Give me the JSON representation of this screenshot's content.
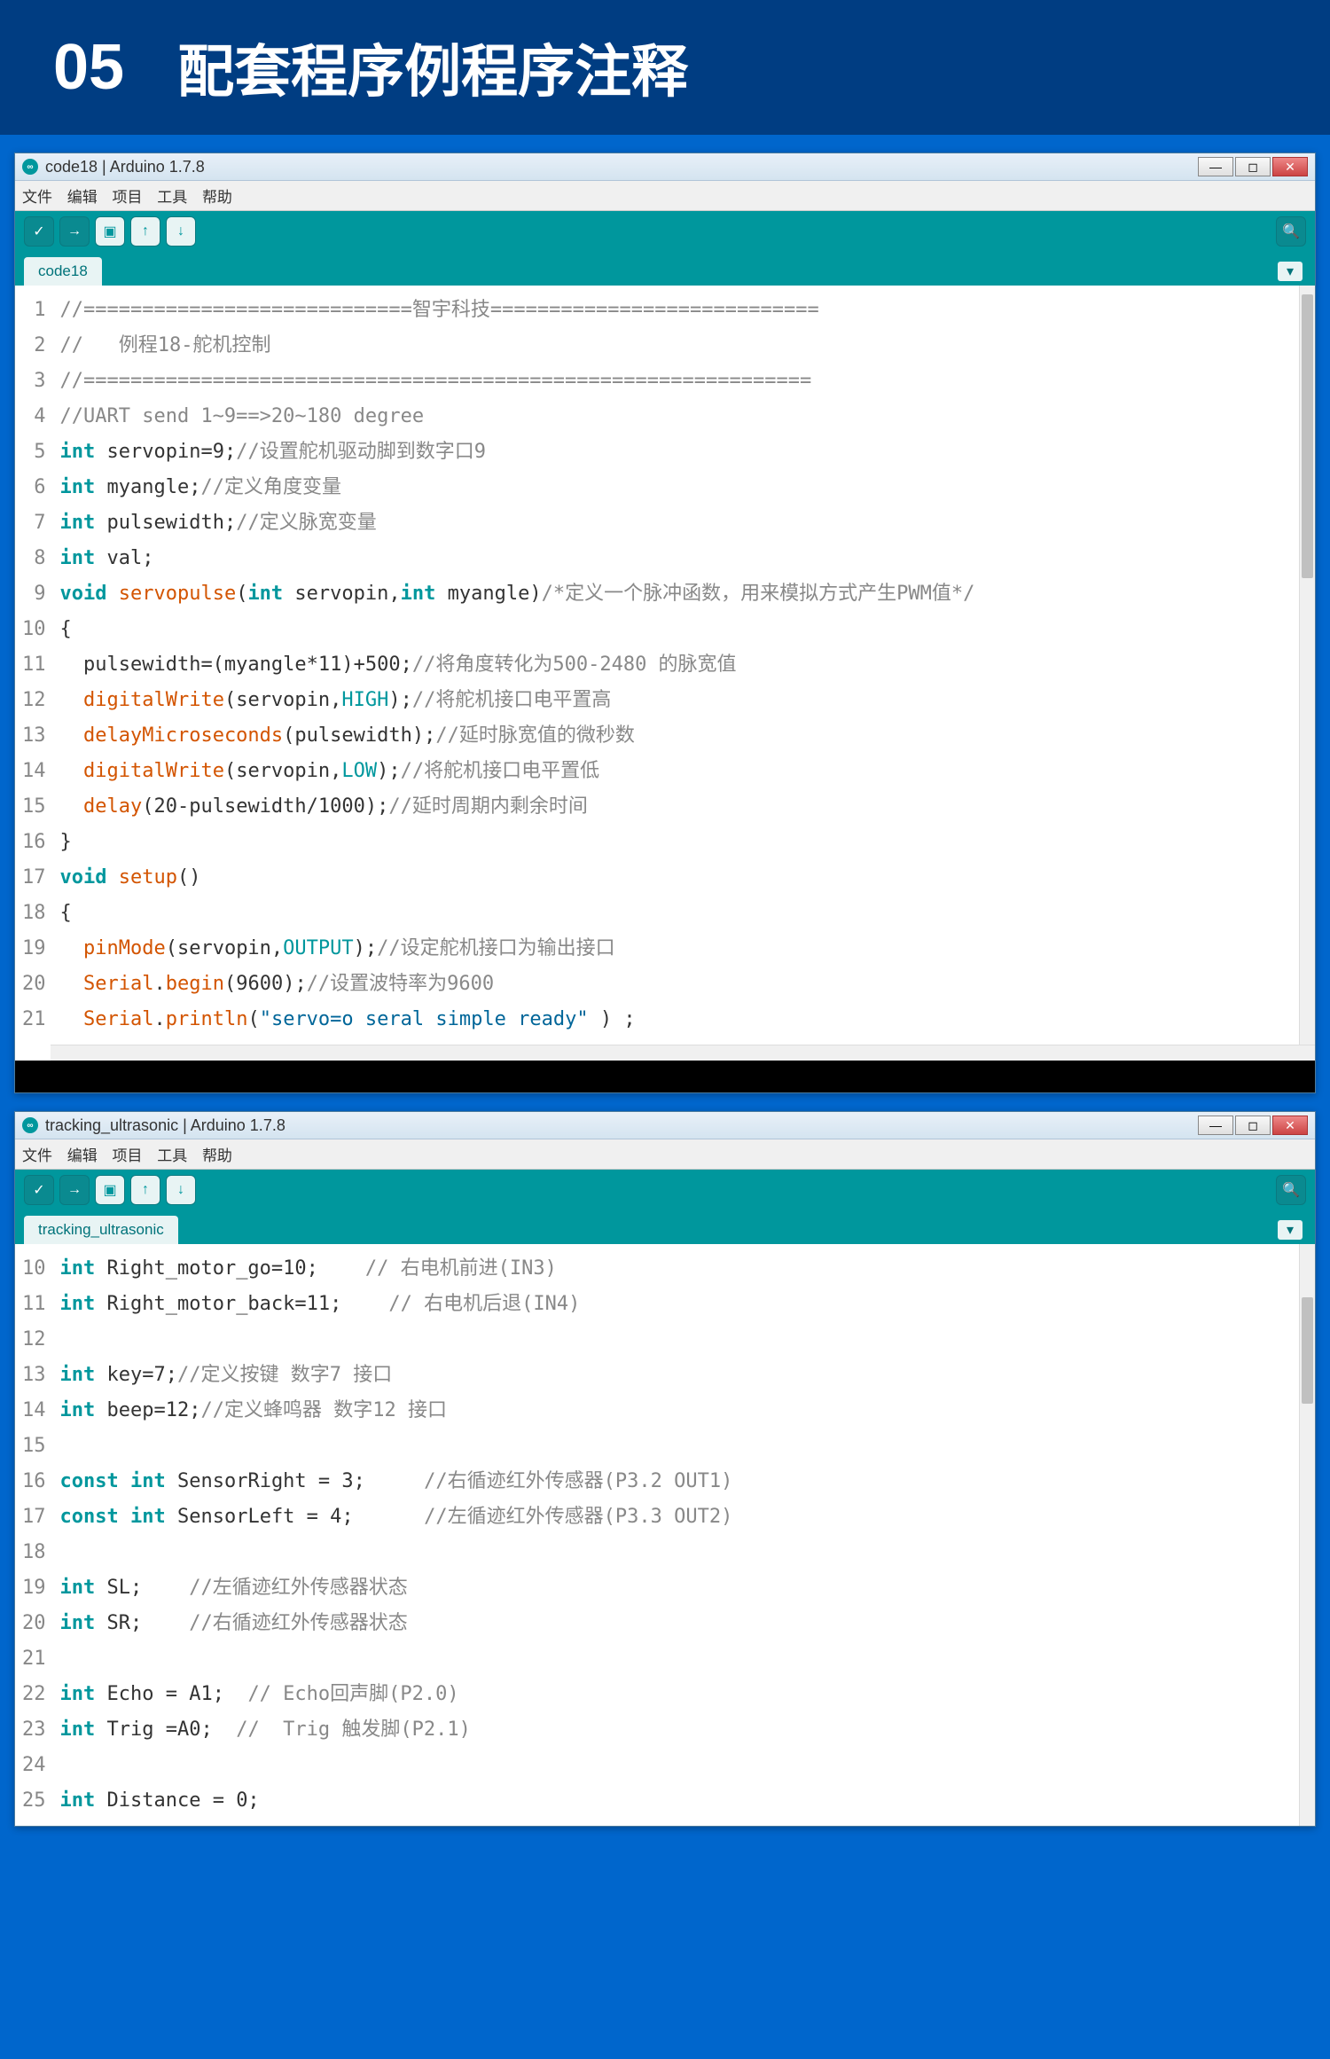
{
  "banner": {
    "num": "05",
    "title": "配套程序例程序注释"
  },
  "window1": {
    "title": "code18 | Arduino 1.7.8",
    "menus": [
      "文件",
      "编辑",
      "项目",
      "工具",
      "帮助"
    ],
    "tab": "code18",
    "lines": [
      {
        "n": 1,
        "tokens": [
          {
            "t": "//============================智宇科技============================",
            "c": "k-cmt"
          }
        ]
      },
      {
        "n": 2,
        "tokens": [
          {
            "t": "//   例程18-舵机控制",
            "c": "k-cmt"
          }
        ]
      },
      {
        "n": 3,
        "tokens": [
          {
            "t": "//==============================================================",
            "c": "k-cmt"
          }
        ]
      },
      {
        "n": 4,
        "tokens": [
          {
            "t": "//UART send 1~9==>20~180 degree",
            "c": "k-cmt"
          }
        ]
      },
      {
        "n": 5,
        "tokens": [
          {
            "t": "int",
            "c": "k-type"
          },
          {
            "t": " servopin=9;"
          },
          {
            "t": "//设置舵机驱动脚到数字口9",
            "c": "k-cmt"
          }
        ]
      },
      {
        "n": 6,
        "tokens": [
          {
            "t": "int",
            "c": "k-type"
          },
          {
            "t": " myangle;"
          },
          {
            "t": "//定义角度变量",
            "c": "k-cmt"
          }
        ]
      },
      {
        "n": 7,
        "tokens": [
          {
            "t": "int",
            "c": "k-type"
          },
          {
            "t": " pulsewidth;"
          },
          {
            "t": "//定义脉宽变量",
            "c": "k-cmt"
          }
        ]
      },
      {
        "n": 8,
        "tokens": [
          {
            "t": "int",
            "c": "k-type"
          },
          {
            "t": " val;"
          }
        ]
      },
      {
        "n": 9,
        "tokens": [
          {
            "t": "void",
            "c": "k-type"
          },
          {
            "t": " "
          },
          {
            "t": "servopulse",
            "c": "k-func"
          },
          {
            "t": "("
          },
          {
            "t": "int",
            "c": "k-type"
          },
          {
            "t": " servopin,"
          },
          {
            "t": "int",
            "c": "k-type"
          },
          {
            "t": " myangle)"
          },
          {
            "t": "/*定义一个脉冲函数，用来模拟方式产生PWM值*/",
            "c": "k-cmt"
          }
        ]
      },
      {
        "n": 10,
        "tokens": [
          {
            "t": "{"
          }
        ]
      },
      {
        "n": 11,
        "tokens": [
          {
            "t": "  pulsewidth=(myangle*11)+500;"
          },
          {
            "t": "//将角度转化为500-2480 的脉宽值",
            "c": "k-cmt"
          }
        ]
      },
      {
        "n": 12,
        "tokens": [
          {
            "t": "  "
          },
          {
            "t": "digitalWrite",
            "c": "k-func"
          },
          {
            "t": "(servopin,"
          },
          {
            "t": "HIGH",
            "c": "k-const"
          },
          {
            "t": ");"
          },
          {
            "t": "//将舵机接口电平置高",
            "c": "k-cmt"
          }
        ]
      },
      {
        "n": 13,
        "tokens": [
          {
            "t": "  "
          },
          {
            "t": "delayMicroseconds",
            "c": "k-func"
          },
          {
            "t": "(pulsewidth);"
          },
          {
            "t": "//延时脉宽值的微秒数",
            "c": "k-cmt"
          }
        ]
      },
      {
        "n": 14,
        "tokens": [
          {
            "t": "  "
          },
          {
            "t": "digitalWrite",
            "c": "k-func"
          },
          {
            "t": "(servopin,"
          },
          {
            "t": "LOW",
            "c": "k-const"
          },
          {
            "t": ");"
          },
          {
            "t": "//将舵机接口电平置低",
            "c": "k-cmt"
          }
        ]
      },
      {
        "n": 15,
        "tokens": [
          {
            "t": "  "
          },
          {
            "t": "delay",
            "c": "k-func"
          },
          {
            "t": "(20-pulsewidth/1000);"
          },
          {
            "t": "//延时周期内剩余时间",
            "c": "k-cmt"
          }
        ]
      },
      {
        "n": 16,
        "tokens": [
          {
            "t": "}"
          }
        ]
      },
      {
        "n": 17,
        "tokens": [
          {
            "t": "void",
            "c": "k-type"
          },
          {
            "t": " "
          },
          {
            "t": "setup",
            "c": "k-func"
          },
          {
            "t": "()"
          }
        ]
      },
      {
        "n": 18,
        "tokens": [
          {
            "t": "{"
          }
        ]
      },
      {
        "n": 19,
        "tokens": [
          {
            "t": "  "
          },
          {
            "t": "pinMode",
            "c": "k-func"
          },
          {
            "t": "(servopin,"
          },
          {
            "t": "OUTPUT",
            "c": "k-const"
          },
          {
            "t": ");"
          },
          {
            "t": "//设定舵机接口为输出接口",
            "c": "k-cmt"
          }
        ]
      },
      {
        "n": 20,
        "tokens": [
          {
            "t": "  "
          },
          {
            "t": "Serial",
            "c": "k-func"
          },
          {
            "t": "."
          },
          {
            "t": "begin",
            "c": "k-func"
          },
          {
            "t": "(9600);"
          },
          {
            "t": "//设置波特率为9600",
            "c": "k-cmt"
          }
        ]
      },
      {
        "n": 21,
        "tokens": [
          {
            "t": "  "
          },
          {
            "t": "Serial",
            "c": "k-func"
          },
          {
            "t": "."
          },
          {
            "t": "println",
            "c": "k-func"
          },
          {
            "t": "("
          },
          {
            "t": "\"servo=o seral simple ready\"",
            "c": "k-str"
          },
          {
            "t": " ) ;"
          }
        ]
      }
    ],
    "scroll": {
      "thumbTop": 10,
      "thumbHeight": 320
    }
  },
  "window2": {
    "title": "tracking_ultrasonic | Arduino 1.7.8",
    "menus": [
      "文件",
      "编辑",
      "项目",
      "工具",
      "帮助"
    ],
    "tab": "tracking_ultrasonic",
    "lines": [
      {
        "n": 10,
        "tokens": [
          {
            "t": "int",
            "c": "k-type"
          },
          {
            "t": " Right_motor_go=10;    "
          },
          {
            "t": "// 右电机前进(IN3)",
            "c": "k-cmt"
          }
        ]
      },
      {
        "n": 11,
        "tokens": [
          {
            "t": "int",
            "c": "k-type"
          },
          {
            "t": " Right_motor_back=11;    "
          },
          {
            "t": "// 右电机后退(IN4)",
            "c": "k-cmt"
          }
        ]
      },
      {
        "n": 12,
        "tokens": []
      },
      {
        "n": 13,
        "tokens": [
          {
            "t": "int",
            "c": "k-type"
          },
          {
            "t": " key=7;"
          },
          {
            "t": "//定义按键 数字7 接口",
            "c": "k-cmt"
          }
        ]
      },
      {
        "n": 14,
        "tokens": [
          {
            "t": "int",
            "c": "k-type"
          },
          {
            "t": " beep=12;"
          },
          {
            "t": "//定义蜂鸣器 数字12 接口",
            "c": "k-cmt"
          }
        ]
      },
      {
        "n": 15,
        "tokens": []
      },
      {
        "n": 16,
        "tokens": [
          {
            "t": "const",
            "c": "k-type"
          },
          {
            "t": " "
          },
          {
            "t": "int",
            "c": "k-type"
          },
          {
            "t": " SensorRight = 3;     "
          },
          {
            "t": "//右循迹红外传感器(P3.2 OUT1)",
            "c": "k-cmt"
          }
        ]
      },
      {
        "n": 17,
        "tokens": [
          {
            "t": "const",
            "c": "k-type"
          },
          {
            "t": " "
          },
          {
            "t": "int",
            "c": "k-type"
          },
          {
            "t": " SensorLeft = 4;      "
          },
          {
            "t": "//左循迹红外传感器(P3.3 OUT2)",
            "c": "k-cmt"
          }
        ]
      },
      {
        "n": 18,
        "tokens": []
      },
      {
        "n": 19,
        "tokens": [
          {
            "t": "int",
            "c": "k-type"
          },
          {
            "t": " SL;    "
          },
          {
            "t": "//左循迹红外传感器状态",
            "c": "k-cmt"
          }
        ]
      },
      {
        "n": 20,
        "tokens": [
          {
            "t": "int",
            "c": "k-type"
          },
          {
            "t": " SR;    "
          },
          {
            "t": "//右循迹红外传感器状态",
            "c": "k-cmt"
          }
        ]
      },
      {
        "n": 21,
        "tokens": []
      },
      {
        "n": 22,
        "tokens": [
          {
            "t": "int",
            "c": "k-type"
          },
          {
            "t": " Echo = A1;  "
          },
          {
            "t": "// Echo回声脚(P2.0)",
            "c": "k-cmt"
          }
        ]
      },
      {
        "n": 23,
        "tokens": [
          {
            "t": "int",
            "c": "k-type"
          },
          {
            "t": " Trig =A0;  "
          },
          {
            "t": "//  Trig 触发脚(P2.1)",
            "c": "k-cmt"
          }
        ]
      },
      {
        "n": 24,
        "tokens": []
      },
      {
        "n": 25,
        "tokens": [
          {
            "t": "int",
            "c": "k-type"
          },
          {
            "t": " Distance = 0;"
          }
        ]
      }
    ],
    "scroll": {
      "thumbTop": 60,
      "thumbHeight": 120
    }
  },
  "icons": {
    "verify": "✓",
    "upload": "→",
    "new": "▣",
    "up": "↑",
    "down": "↓",
    "serial": "🔍",
    "min": "—",
    "max": "◻",
    "close": "✕",
    "dropdown": "▾"
  }
}
